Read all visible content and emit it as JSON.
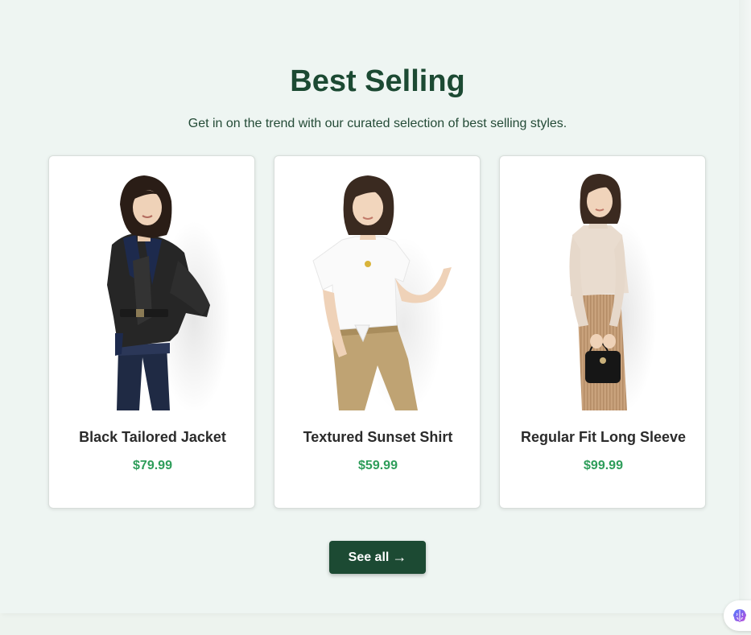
{
  "section": {
    "title": "Best Selling",
    "subtitle": "Get in on the trend with our curated selection of best selling styles."
  },
  "products": [
    {
      "name": "Black Tailored Jacket",
      "price": "$79.99",
      "image": "woman-black-leather-jacket-photo"
    },
    {
      "name": "Textured Sunset Shirt",
      "price": "$59.99",
      "image": "woman-white-tshirt-khaki-pants-photo"
    },
    {
      "name": "Regular Fit Long Sleeve",
      "price": "$99.99",
      "image": "woman-beige-turtleneck-skirt-photo"
    }
  ],
  "see_all": {
    "label": "See all",
    "arrow": "→"
  },
  "assistant": {
    "icon": "brain-icon"
  },
  "colors": {
    "accent": "#1c4a33",
    "price": "#2e9d5a",
    "background": "#eef5f2"
  }
}
